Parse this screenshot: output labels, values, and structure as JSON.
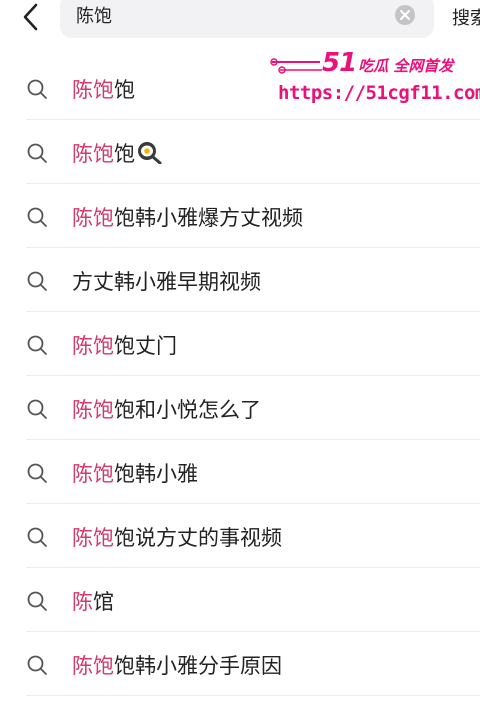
{
  "search": {
    "query": "陈饱",
    "submit_label": "搜索"
  },
  "watermark": {
    "brand_number": "51",
    "brand_text": "吃瓜 全网首发",
    "url": "https://51cgf11.com"
  },
  "suggestions": [
    {
      "highlight": "陈饱",
      "rest": "饱",
      "has_egg_icon": false
    },
    {
      "highlight": "陈饱",
      "rest": "饱",
      "has_egg_icon": true
    },
    {
      "highlight": "陈饱",
      "rest": "饱韩小雅爆方丈视频",
      "has_egg_icon": false
    },
    {
      "highlight": "",
      "rest": "方丈韩小雅早期视频",
      "has_egg_icon": false
    },
    {
      "highlight": "陈饱",
      "rest": "饱丈门",
      "has_egg_icon": false
    },
    {
      "highlight": "陈饱",
      "rest": "饱和小悦怎么了",
      "has_egg_icon": false
    },
    {
      "highlight": "陈饱",
      "rest": "饱韩小雅",
      "has_egg_icon": false
    },
    {
      "highlight": "陈饱",
      "rest": "饱说方丈的事视频",
      "has_egg_icon": false
    },
    {
      "highlight": "陈",
      "rest": "馆",
      "has_egg_icon": false
    },
    {
      "highlight": "陈饱",
      "rest": "饱韩小雅分手原因",
      "has_egg_icon": false
    }
  ],
  "colors": {
    "highlight": "#d13b6a",
    "watermark": "#e8127a",
    "search_bg": "#f2f2f4"
  }
}
